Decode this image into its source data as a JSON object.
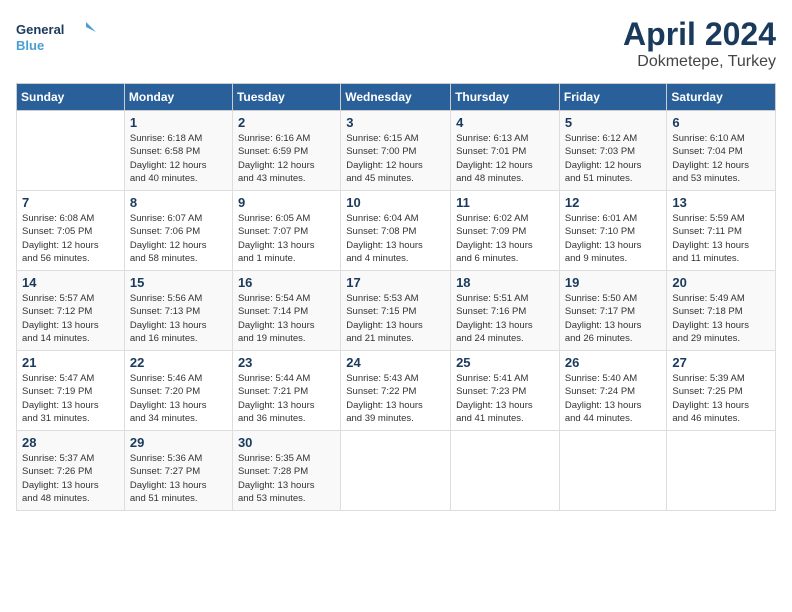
{
  "logo": {
    "line1": "General",
    "line2": "Blue"
  },
  "title": "April 2024",
  "location": "Dokmetepe, Turkey",
  "weekdays": [
    "Sunday",
    "Monday",
    "Tuesday",
    "Wednesday",
    "Thursday",
    "Friday",
    "Saturday"
  ],
  "weeks": [
    [
      {
        "day": "",
        "info": ""
      },
      {
        "day": "1",
        "info": "Sunrise: 6:18 AM\nSunset: 6:58 PM\nDaylight: 12 hours\nand 40 minutes."
      },
      {
        "day": "2",
        "info": "Sunrise: 6:16 AM\nSunset: 6:59 PM\nDaylight: 12 hours\nand 43 minutes."
      },
      {
        "day": "3",
        "info": "Sunrise: 6:15 AM\nSunset: 7:00 PM\nDaylight: 12 hours\nand 45 minutes."
      },
      {
        "day": "4",
        "info": "Sunrise: 6:13 AM\nSunset: 7:01 PM\nDaylight: 12 hours\nand 48 minutes."
      },
      {
        "day": "5",
        "info": "Sunrise: 6:12 AM\nSunset: 7:03 PM\nDaylight: 12 hours\nand 51 minutes."
      },
      {
        "day": "6",
        "info": "Sunrise: 6:10 AM\nSunset: 7:04 PM\nDaylight: 12 hours\nand 53 minutes."
      }
    ],
    [
      {
        "day": "7",
        "info": "Sunrise: 6:08 AM\nSunset: 7:05 PM\nDaylight: 12 hours\nand 56 minutes."
      },
      {
        "day": "8",
        "info": "Sunrise: 6:07 AM\nSunset: 7:06 PM\nDaylight: 12 hours\nand 58 minutes."
      },
      {
        "day": "9",
        "info": "Sunrise: 6:05 AM\nSunset: 7:07 PM\nDaylight: 13 hours\nand 1 minute."
      },
      {
        "day": "10",
        "info": "Sunrise: 6:04 AM\nSunset: 7:08 PM\nDaylight: 13 hours\nand 4 minutes."
      },
      {
        "day": "11",
        "info": "Sunrise: 6:02 AM\nSunset: 7:09 PM\nDaylight: 13 hours\nand 6 minutes."
      },
      {
        "day": "12",
        "info": "Sunrise: 6:01 AM\nSunset: 7:10 PM\nDaylight: 13 hours\nand 9 minutes."
      },
      {
        "day": "13",
        "info": "Sunrise: 5:59 AM\nSunset: 7:11 PM\nDaylight: 13 hours\nand 11 minutes."
      }
    ],
    [
      {
        "day": "14",
        "info": "Sunrise: 5:57 AM\nSunset: 7:12 PM\nDaylight: 13 hours\nand 14 minutes."
      },
      {
        "day": "15",
        "info": "Sunrise: 5:56 AM\nSunset: 7:13 PM\nDaylight: 13 hours\nand 16 minutes."
      },
      {
        "day": "16",
        "info": "Sunrise: 5:54 AM\nSunset: 7:14 PM\nDaylight: 13 hours\nand 19 minutes."
      },
      {
        "day": "17",
        "info": "Sunrise: 5:53 AM\nSunset: 7:15 PM\nDaylight: 13 hours\nand 21 minutes."
      },
      {
        "day": "18",
        "info": "Sunrise: 5:51 AM\nSunset: 7:16 PM\nDaylight: 13 hours\nand 24 minutes."
      },
      {
        "day": "19",
        "info": "Sunrise: 5:50 AM\nSunset: 7:17 PM\nDaylight: 13 hours\nand 26 minutes."
      },
      {
        "day": "20",
        "info": "Sunrise: 5:49 AM\nSunset: 7:18 PM\nDaylight: 13 hours\nand 29 minutes."
      }
    ],
    [
      {
        "day": "21",
        "info": "Sunrise: 5:47 AM\nSunset: 7:19 PM\nDaylight: 13 hours\nand 31 minutes."
      },
      {
        "day": "22",
        "info": "Sunrise: 5:46 AM\nSunset: 7:20 PM\nDaylight: 13 hours\nand 34 minutes."
      },
      {
        "day": "23",
        "info": "Sunrise: 5:44 AM\nSunset: 7:21 PM\nDaylight: 13 hours\nand 36 minutes."
      },
      {
        "day": "24",
        "info": "Sunrise: 5:43 AM\nSunset: 7:22 PM\nDaylight: 13 hours\nand 39 minutes."
      },
      {
        "day": "25",
        "info": "Sunrise: 5:41 AM\nSunset: 7:23 PM\nDaylight: 13 hours\nand 41 minutes."
      },
      {
        "day": "26",
        "info": "Sunrise: 5:40 AM\nSunset: 7:24 PM\nDaylight: 13 hours\nand 44 minutes."
      },
      {
        "day": "27",
        "info": "Sunrise: 5:39 AM\nSunset: 7:25 PM\nDaylight: 13 hours\nand 46 minutes."
      }
    ],
    [
      {
        "day": "28",
        "info": "Sunrise: 5:37 AM\nSunset: 7:26 PM\nDaylight: 13 hours\nand 48 minutes."
      },
      {
        "day": "29",
        "info": "Sunrise: 5:36 AM\nSunset: 7:27 PM\nDaylight: 13 hours\nand 51 minutes."
      },
      {
        "day": "30",
        "info": "Sunrise: 5:35 AM\nSunset: 7:28 PM\nDaylight: 13 hours\nand 53 minutes."
      },
      {
        "day": "",
        "info": ""
      },
      {
        "day": "",
        "info": ""
      },
      {
        "day": "",
        "info": ""
      },
      {
        "day": "",
        "info": ""
      }
    ]
  ]
}
